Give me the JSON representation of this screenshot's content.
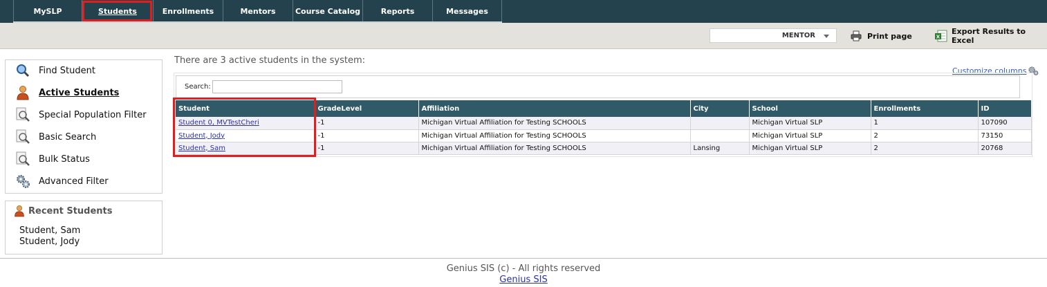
{
  "nav": {
    "tabs": [
      {
        "label": "MySLP"
      },
      {
        "label": "Students"
      },
      {
        "label": "Enrollments"
      },
      {
        "label": "Mentors"
      },
      {
        "label": "Course Catalog"
      },
      {
        "label": "Reports"
      },
      {
        "label": "Messages"
      }
    ],
    "active_tab": "Students"
  },
  "toolbar": {
    "role": "MENTOR",
    "print_label": "Print page",
    "export_label": "Export Results to Excel"
  },
  "sidebar": {
    "items": [
      {
        "label": "Find Student",
        "icon": "magnifier-icon"
      },
      {
        "label": "Active Students",
        "icon": "person-icon"
      },
      {
        "label": "Special Population Filter",
        "icon": "document-search-icon"
      },
      {
        "label": "Basic Search",
        "icon": "document-search-icon"
      },
      {
        "label": "Bulk Status",
        "icon": "document-search-icon"
      },
      {
        "label": "Advanced Filter",
        "icon": "gears-icon"
      }
    ],
    "recent_title": "Recent Students",
    "recent": [
      "Student, Sam",
      "Student, Jody"
    ]
  },
  "main": {
    "summary": "There are 3 active students in the system:",
    "customize_label": "Customize columns",
    "search_label": "Search:",
    "search_value": "",
    "columns": [
      "Student",
      "GradeLevel",
      "Affiliation",
      "City",
      "School",
      "Enrollments",
      "ID"
    ],
    "rows": [
      [
        "Student 0, MVTestCheri",
        "-1",
        "Michigan Virtual Affiliation for Testing SCHOOLS",
        "",
        "Michigan Virtual SLP",
        "1",
        "107090"
      ],
      [
        "Student, Jody",
        "-1",
        "Michigan Virtual Affiliation for Testing SCHOOLS",
        "",
        "Michigan Virtual SLP",
        "2",
        "73150"
      ],
      [
        "Student, Sam",
        "-1",
        "Michigan Virtual Affiliation for Testing SCHOOLS",
        "Lansing",
        "Michigan Virtual SLP",
        "2",
        "20768"
      ]
    ]
  },
  "footer": {
    "copyright": "Genius SIS (c) - All rights reserved",
    "link": "Genius SIS"
  },
  "colors": {
    "nav_bg": "#23424e",
    "header_bg": "#315a69",
    "highlight": "#e01e1e",
    "link": "#2a32a8"
  }
}
